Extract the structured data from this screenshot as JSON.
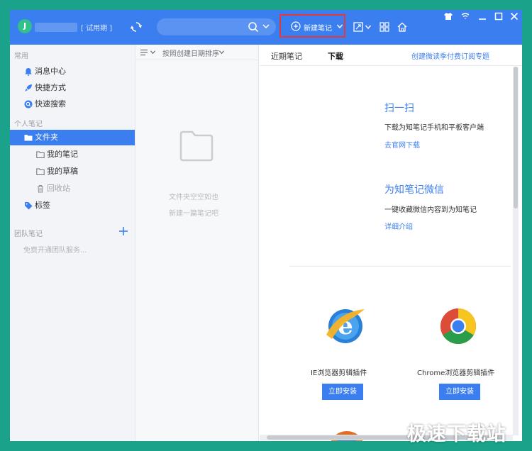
{
  "colors": {
    "accent": "#3b7ef0",
    "frame": "#1aa38a",
    "highlight_box": "#e53a3a",
    "avatar": "#34c08a"
  },
  "titlebar": {
    "avatar_letter": "J",
    "trial_badge": "[ 试用期 ]",
    "new_note_label": "新建笔记",
    "icons": [
      "sync-icon",
      "search-icon",
      "chevron-down-icon",
      "plus-circle-icon",
      "expand-icon",
      "grid-icon",
      "home-icon",
      "shirt-icon",
      "wifi-icon",
      "minimize-icon",
      "maximize-icon",
      "close-icon"
    ]
  },
  "sidebar": {
    "section_common": "常用",
    "items_common": [
      {
        "label": "消息中心",
        "icon": "bell-icon"
      },
      {
        "label": "快捷方式",
        "icon": "rocket-icon"
      },
      {
        "label": "快速搜索",
        "icon": "search-circle-icon"
      }
    ],
    "section_personal": "个人笔记",
    "folder": {
      "label": "文件夹",
      "icon": "folder-icon"
    },
    "subitems": [
      {
        "label": "我的笔记",
        "icon": "folder-outline-icon"
      },
      {
        "label": "我的草稿",
        "icon": "folder-outline-icon"
      },
      {
        "label": "回收站",
        "icon": "trash-icon"
      }
    ],
    "tags": {
      "label": "标签",
      "icon": "tag-icon"
    },
    "section_team": "团队笔记",
    "team_hint": "免费开通团队服务..."
  },
  "notelist": {
    "sort_label": "按照创建日期排序",
    "empty_line1": "文件夹空空如也",
    "empty_line2": "新建一篇笔记吧"
  },
  "content": {
    "tabs": [
      "近期笔记",
      "下载"
    ],
    "active_tab": "下载",
    "top_link": "创建微读季付费订阅专题",
    "scan": {
      "title": "扫一扫",
      "desc": "下载为知笔记手机和平板客户端",
      "link": "去官网下载"
    },
    "wechat": {
      "title": "为知笔记微信",
      "desc": "一键收藏微信内容到为知笔记",
      "link": "详细介绍"
    },
    "plugins": [
      {
        "name": "IE浏览器剪辑插件",
        "button": "立即安装",
        "icon": "ie-logo-icon"
      },
      {
        "name": "Chrome浏览器剪辑插件",
        "button": "立即安装",
        "icon": "chrome-logo-icon"
      }
    ]
  },
  "watermark": "极速下载站"
}
